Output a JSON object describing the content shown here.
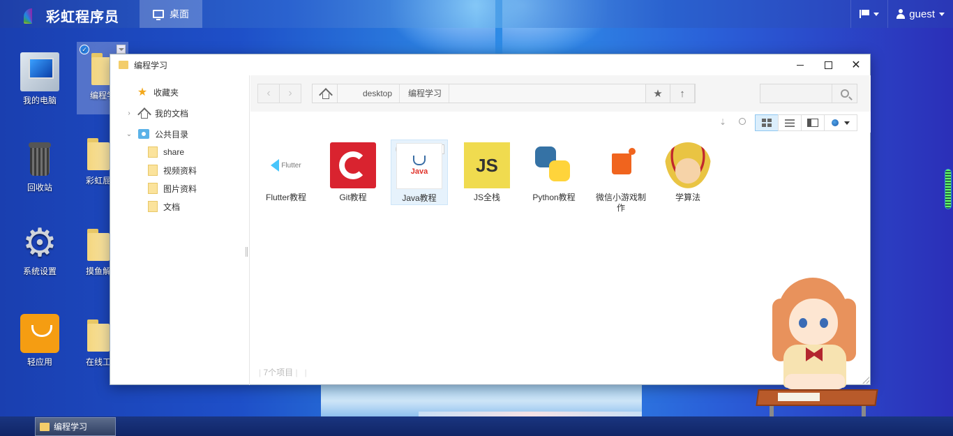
{
  "topbar": {
    "brand": "彩虹程序员",
    "desktop_tab": "桌面",
    "user": "guest"
  },
  "desktop_icons": [
    {
      "label": "我的电脑"
    },
    {
      "label": "回收站"
    },
    {
      "label": "系统设置"
    },
    {
      "label": "轻应用"
    },
    {
      "label": "编程学"
    },
    {
      "label": "彩虹屁"
    },
    {
      "label": "摸鱼解"
    },
    {
      "label": "在线工"
    }
  ],
  "window": {
    "title": "编程学习",
    "sidebar": {
      "favorites": "收藏夹",
      "my_docs": "我的文档",
      "public": "公共目录",
      "children": [
        "share",
        "视频资料",
        "图片资料",
        "文档"
      ]
    },
    "breadcrumbs": [
      "desktop",
      "编程学习"
    ],
    "search": {
      "placeholder": ""
    },
    "files": [
      {
        "label": "Flutter教程",
        "icon": "flutter-icon"
      },
      {
        "label": "Git教程",
        "icon": "git-icon"
      },
      {
        "label": "Java教程",
        "icon": "java-icon"
      },
      {
        "label": "JS全栈",
        "icon": "js-icon"
      },
      {
        "label": "Python教程",
        "icon": "python-icon"
      },
      {
        "label": "微信小游戏制作",
        "icon": "wechat-game-icon"
      },
      {
        "label": "学算法",
        "icon": "luffy-icon"
      }
    ],
    "flutter_thumb_text": "Flutter",
    "java_thumb_text": "Java",
    "js_thumb_text": "JS",
    "status": "7个项目"
  },
  "taskbar": {
    "items": [
      "编程学习"
    ]
  },
  "colors": {
    "accent": "#2b7fe0",
    "git_red": "#d9232f",
    "js_yellow": "#f0db4f",
    "star": "#f3a81c"
  }
}
